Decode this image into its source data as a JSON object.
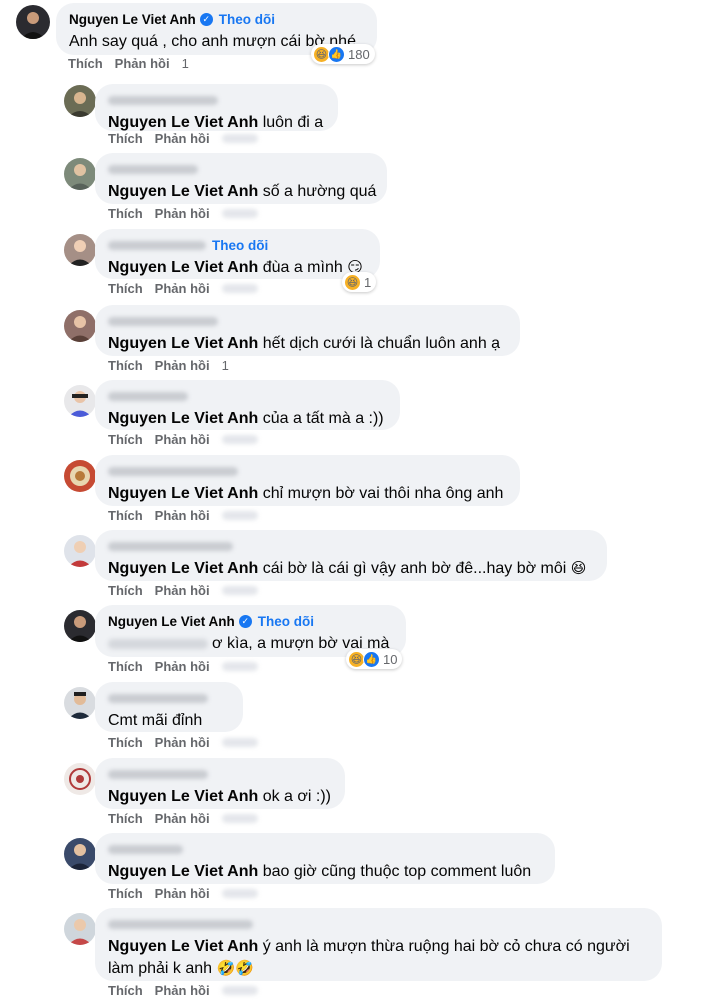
{
  "top_comment": {
    "author": "Nguyen Le Viet Anh",
    "follow_label": "Theo dõi",
    "text": "Anh say quá , cho anh mượn cái bờ nhé .",
    "reaction_count": "180",
    "like_label": "Thích",
    "reply_label": "Phản hồi",
    "time": "1"
  },
  "replies": [
    {
      "tag": "Nguyen Le Viet Anh",
      "text": " luôn đi a",
      "like_label": "Thích",
      "reply_label": "Phản hồi"
    },
    {
      "tag": "Nguyen Le Viet Anh",
      "text": " số a hường quá",
      "like_label": "Thích",
      "reply_label": "Phản hồi"
    },
    {
      "tag": "Nguyen Le Viet Anh",
      "text": " đùa a mình",
      "emoji": "😏",
      "follow_label": "Theo dõi",
      "reaction_count": "1",
      "like_label": "Thích",
      "reply_label": "Phản hồi"
    },
    {
      "tag": "Nguyen Le Viet Anh",
      "text": " hết dịch cưới là chuẩn luôn anh ạ",
      "like_label": "Thích",
      "reply_label": "Phản hồi",
      "time": "1"
    },
    {
      "tag": "Nguyen Le Viet Anh",
      "text": " của a tất mà a :))",
      "like_label": "Thích",
      "reply_label": "Phản hồi"
    },
    {
      "tag": "Nguyen Le Viet Anh",
      "text": " chỉ mượn bờ vai thôi nha ông anh",
      "like_label": "Thích",
      "reply_label": "Phản hồi"
    },
    {
      "tag": "Nguyen Le Viet Anh",
      "text": " cái bờ là cái gì vậy anh bờ đê...hay bờ môi",
      "emoji": "😆",
      "like_label": "Thích",
      "reply_label": "Phản hồi"
    },
    {
      "author": "Nguyen Le Viet Anh",
      "follow_label": "Theo dõi",
      "text": "ơ kìa, a mượn bờ vai mà",
      "reaction_count": "10",
      "like_label": "Thích",
      "reply_label": "Phản hồi"
    },
    {
      "text": "Cmt mãi đỉnh",
      "like_label": "Thích",
      "reply_label": "Phản hồi"
    },
    {
      "tag": "Nguyen Le Viet Anh",
      "text": " ok a ơi :))",
      "like_label": "Thích",
      "reply_label": "Phản hồi"
    },
    {
      "tag": "Nguyen Le Viet Anh",
      "text": " bao giờ cũng thuộc top comment luôn",
      "like_label": "Thích",
      "reply_label": "Phản hồi"
    },
    {
      "tag": "Nguyen Le Viet Anh",
      "text": " ý anh là mượn thừa ruộng hai bờ cỏ chưa có người",
      "text_line2": "làm phải k anh",
      "emoji": "🤣🤣",
      "like_label": "Thích",
      "reply_label": "Phản hồi"
    }
  ],
  "colors": {
    "bubble": "#f0f2f5",
    "link_blue": "#1877f2",
    "secondary_text": "#65676b",
    "primary_text": "#050505"
  },
  "icons": [
    "verified-badge-icon",
    "haha-reaction-icon",
    "like-reaction-icon",
    "avatar"
  ]
}
